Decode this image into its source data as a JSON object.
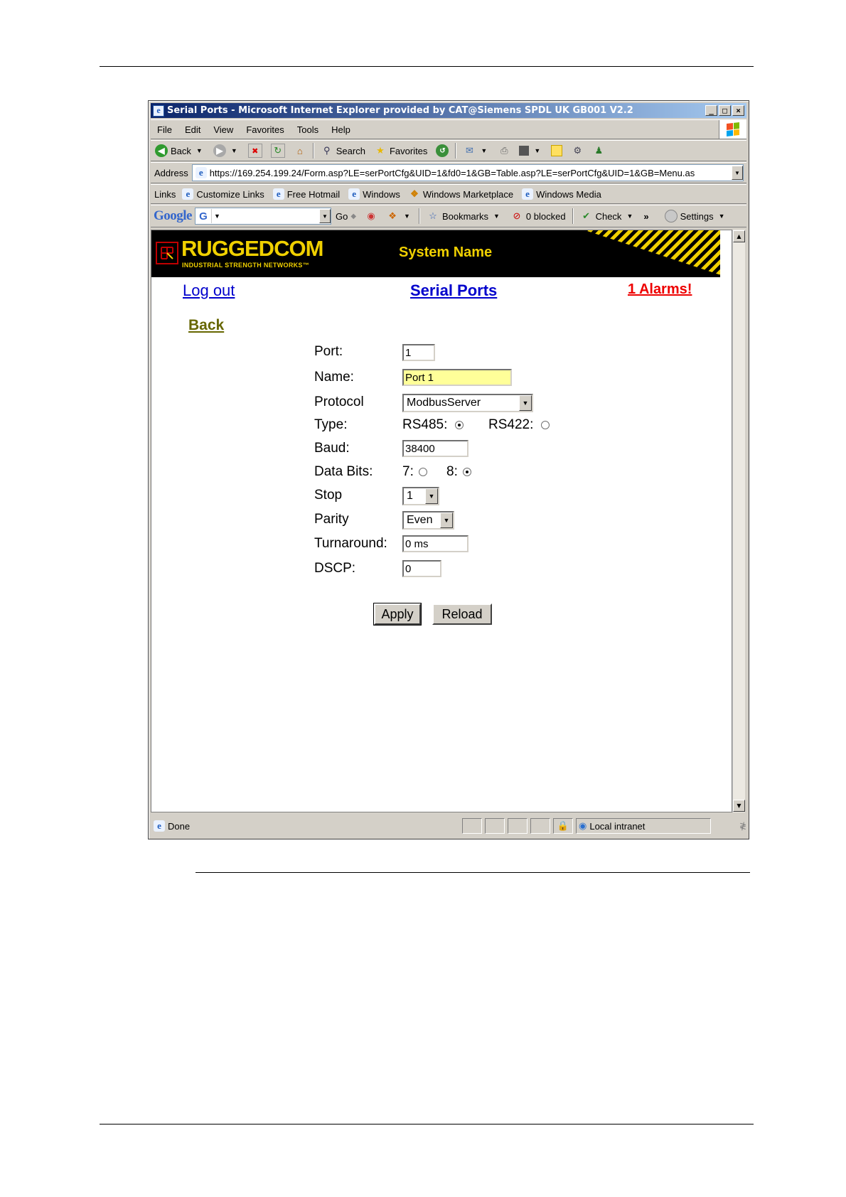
{
  "window": {
    "title": "Serial Ports - Microsoft Internet Explorer provided by CAT@Siemens SPDL UK GB001 V2.2",
    "buttons": [
      "_",
      "□",
      "×"
    ]
  },
  "menu": [
    "File",
    "Edit",
    "View",
    "Favorites",
    "Tools",
    "Help"
  ],
  "toolbar": {
    "back": "Back",
    "search": "Search",
    "favorites": "Favorites"
  },
  "address": {
    "label": "Address",
    "url": "https://169.254.199.24/Form.asp?LE=serPortCfg&UID=1&fd0=1&GB=Table.asp?LE=serPortCfg&UID=1&GB=Menu.as"
  },
  "links": {
    "label": "Links",
    "items": [
      "Customize Links",
      "Free Hotmail",
      "Windows",
      "Windows Marketplace",
      "Windows Media"
    ]
  },
  "google": {
    "logo": "Google",
    "go": "Go",
    "bookmarks": "Bookmarks",
    "blocked": "0 blocked",
    "check": "Check",
    "more": "»",
    "settings": "Settings"
  },
  "header": {
    "brand": "RUGGEDCOM",
    "tagline": "INDUSTRIAL STRENGTH NETWORKS™",
    "system_name": "System Name"
  },
  "nav": {
    "logout": "Log out",
    "page_title": "Serial Ports",
    "alarms": "1 Alarms!",
    "back": "Back"
  },
  "form": {
    "port_label": "Port:",
    "port_value": "1",
    "name_label": "Name:",
    "name_value": "Port 1",
    "protocol_label": "Protocol",
    "protocol_value": "ModbusServer",
    "type_label": "Type:",
    "type_rs485": "RS485:",
    "type_rs422": "RS422:",
    "type_selected": "RS485",
    "baud_label": "Baud:",
    "baud_value": "38400",
    "databits_label": "Data Bits:",
    "databits_7": "7:",
    "databits_8": "8:",
    "databits_selected": "8",
    "stop_label": "Stop",
    "stop_value": "1",
    "parity_label": "Parity",
    "parity_value": "Even",
    "turnaround_label": "Turnaround:",
    "turnaround_value": "0 ms",
    "dscp_label": "DSCP:",
    "dscp_value": "0",
    "apply": "Apply",
    "reload": "Reload"
  },
  "status": {
    "text": "Done",
    "zone": "Local intranet"
  },
  "colors": {
    "link": "#0000cc",
    "alarm": "#ee0000",
    "back_link": "#666600",
    "brand_yellow": "#f0d000",
    "name_field_bg": "#ffff99"
  }
}
